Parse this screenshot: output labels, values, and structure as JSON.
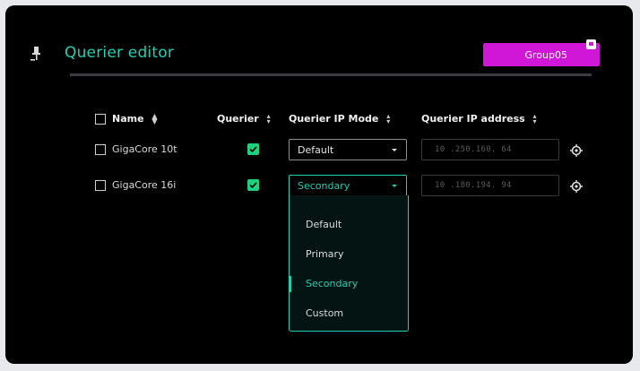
{
  "editor": {
    "title": "Querier editor",
    "group_label": "Group05",
    "pin_icon": "pin-icon"
  },
  "table": {
    "headers": [
      "Name",
      "Querier",
      "Querier IP Mode",
      "Querier IP address"
    ],
    "rows": [
      {
        "name": "GigaCore 10t",
        "querier": true,
        "mode": "Default",
        "ip": "10 .250.160. 64"
      },
      {
        "name": "GigaCore 16i",
        "querier": true,
        "mode": "Secondary",
        "ip": "10 .180.194. 94"
      }
    ]
  },
  "dropdown": {
    "options": [
      "Default",
      "Primary",
      "Secondary",
      "Custom"
    ],
    "selected": "Secondary"
  },
  "colors": {
    "accent": "#1ed1b4",
    "group": "#d016d6",
    "check": "#1ed17f"
  }
}
